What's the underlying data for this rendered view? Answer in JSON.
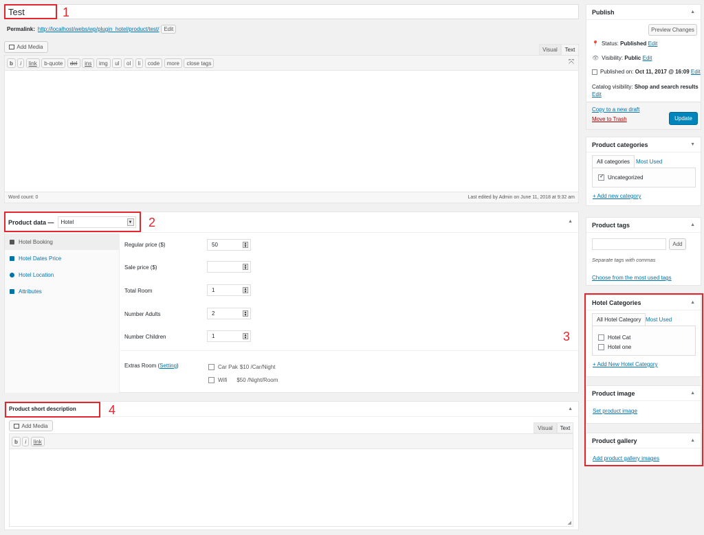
{
  "title": {
    "value": "Test"
  },
  "permalink": {
    "label": "Permalink:",
    "url": "http://localhost/webs/wp/plugin_hotel/product/test/",
    "edit": "Edit"
  },
  "editor": {
    "add_media": "Add Media",
    "tab_visual": "Visual",
    "tab_text": "Text",
    "quicktags": [
      "b",
      "i",
      "link",
      "b-quote",
      "del",
      "ins",
      "img",
      "ul",
      "ol",
      "li",
      "code",
      "more",
      "close tags"
    ],
    "word_count": "Word count: 0",
    "last_edited": "Last edited by Admin on June 11, 2018 at 9:32 am"
  },
  "product_data": {
    "label": "Product data —",
    "type_value": "Hotel",
    "tabs": [
      {
        "label": "Hotel Booking",
        "icon": "home-icon"
      },
      {
        "label": "Hotel Dates Price",
        "icon": "calendar-icon"
      },
      {
        "label": "Hotel Location",
        "icon": "globe-icon"
      },
      {
        "label": "Attributes",
        "icon": "table-icon"
      }
    ],
    "fields": [
      {
        "label": "Regular price ($)",
        "value": "50"
      },
      {
        "label": "Sale price ($)",
        "value": ""
      },
      {
        "label": "Total Room",
        "value": "1"
      },
      {
        "label": "Number Adults",
        "value": "2"
      },
      {
        "label": "Number Children",
        "value": "1"
      }
    ],
    "extras_label": "Extras Room",
    "extras_setting": "Setting",
    "extras": [
      {
        "name": "Car Pak",
        "price": "$10 /Car/Night"
      },
      {
        "name": "Wifi",
        "price": "$50 /Night/Room"
      }
    ]
  },
  "short_desc": {
    "title": "Product short description",
    "add_media": "Add Media",
    "tab_visual": "Visual",
    "tab_text": "Text",
    "quicktags": [
      "b",
      "i",
      "link"
    ]
  },
  "publish": {
    "title": "Publish",
    "preview": "Preview Changes",
    "status_label": "Status:",
    "status_value": "Published",
    "visibility_label": "Visibility:",
    "visibility_value": "Public",
    "published_label": "Published on:",
    "published_value": "Oct 11, 2017 @ 16:09",
    "catalog_label": "Catalog visibility:",
    "catalog_value": "Shop and search results",
    "edit": "Edit",
    "copy_draft": "Copy to a new draft",
    "trash": "Move to Trash",
    "update": "Update"
  },
  "categories": {
    "title": "Product categories",
    "tab_all": "All categories",
    "tab_used": "Most Used",
    "items": [
      "Uncategorized"
    ],
    "add": "+ Add new category"
  },
  "tags": {
    "title": "Product tags",
    "add": "Add",
    "hint": "Separate tags with commas",
    "choose": "Choose from the most used tags"
  },
  "hotel_categories": {
    "title": "Hotel Categories",
    "tab_all": "All Hotel Category",
    "tab_used": "Most Used",
    "items": [
      "Hotel Cat",
      "Hotel one"
    ],
    "add": "+ Add New Hotel Category"
  },
  "product_image": {
    "title": "Product image",
    "link": "Set product image"
  },
  "product_gallery": {
    "title": "Product gallery",
    "link": "Add product gallery images"
  },
  "annotations": [
    "1",
    "2",
    "3",
    "4"
  ],
  "colors": {
    "accent": "#0073aa",
    "annotation": "#e2262d",
    "update_button": "#0085ba",
    "trash": "#a00"
  }
}
